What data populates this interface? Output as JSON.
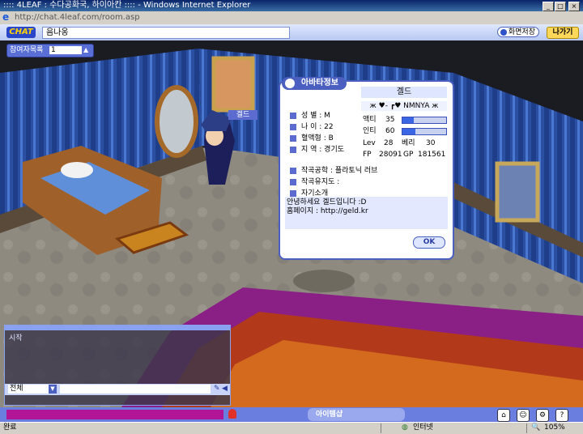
{
  "window": {
    "title": ":::: 4LEAF : 수다공화국, 하이아칸 :::: - Windows Internet Explorer",
    "address": "http://chat.4leaf.com/room.asp"
  },
  "chatbar": {
    "logo": "CHAT",
    "room_name": "음나옹",
    "screen_button": "화면저장",
    "exit_button": "나가기"
  },
  "participants": {
    "label": "참여자목록",
    "count": "1"
  },
  "avatar_tag": "겔드",
  "profile": {
    "header": "아바타정보",
    "name": "겔드",
    "nickname": "ж ♥- ┏♥ NMNYA ж",
    "fields": [
      {
        "label": "성  별 : M"
      },
      {
        "label": "나  이 : 22"
      },
      {
        "label": "혈액형 : B"
      },
      {
        "label": "지  역 : 경기도"
      }
    ],
    "stats": {
      "act_label": "액티",
      "act_value": "35",
      "act_fill": 0.25,
      "int_label": "인티",
      "int_value": "60",
      "int_fill": 0.3,
      "lev_label": "Lev",
      "lev_value": "28",
      "beri_label": "베리",
      "beri_value": "30",
      "fp_label": "FP",
      "fp_value": "28091",
      "gp_label": "GP",
      "gp_value": "181561"
    },
    "favorite_building": "작곡공학  : 플라토닉 러브",
    "fan_club": "작곡유지도 :",
    "intro_label": "자기소개",
    "intro_text": "안녕하세요 겔드입니다 :D\n홈페이지 : http://geld.kr",
    "ok_button": "OK"
  },
  "chat": {
    "log_line": "시작",
    "target": "전체",
    "input_value": ""
  },
  "gamebar": {
    "room_button": "아이템샵"
  },
  "statusbar": {
    "left": "완료",
    "zone": "인터넷",
    "zoom": "105%"
  },
  "colors": {
    "titlebar": "#0a246a",
    "wall_blue": "#2a4fa3",
    "popup_border": "#4b5fc0",
    "carpet_magenta": "#b21497"
  }
}
